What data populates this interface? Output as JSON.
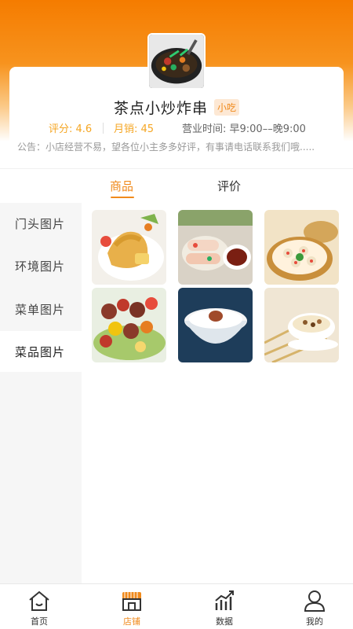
{
  "shop": {
    "name": "茶点小炒炸串",
    "tag": "小吃",
    "rating": "评分: 4.6",
    "sales": "月销: 45",
    "hours": "营业时间: 早9:00––晚9:00",
    "notice": "公告：小店经营不易，望各位小主多多好评，有事请电话联系我们哦....."
  },
  "tabs": [
    {
      "label": "商品",
      "active": true
    },
    {
      "label": "评价",
      "active": false
    }
  ],
  "sidebar": {
    "items": [
      {
        "label": "门头图片",
        "active": false
      },
      {
        "label": "环境图片",
        "active": false
      },
      {
        "label": "菜单图片",
        "active": false
      },
      {
        "label": "菜品图片",
        "active": true
      }
    ]
  },
  "gallery": {
    "images": [
      {
        "icon": "tempura-image"
      },
      {
        "icon": "spring-roll-image"
      },
      {
        "icon": "dim-sum-image"
      },
      {
        "icon": "kebab-image"
      },
      {
        "icon": "rice-bowl-image"
      },
      {
        "icon": "cereal-bowl-image"
      }
    ]
  },
  "bottom_nav": {
    "items": [
      {
        "label": "首页",
        "icon": "home-icon",
        "active": false
      },
      {
        "label": "店铺",
        "icon": "shop-icon",
        "active": true
      },
      {
        "label": "数据",
        "icon": "chart-icon",
        "active": false
      },
      {
        "label": "我的",
        "icon": "user-icon",
        "active": false
      }
    ]
  },
  "colors": {
    "accent": "#f08a1c",
    "header_gradient_top": "#f57c00",
    "rating": "#f5a623"
  }
}
